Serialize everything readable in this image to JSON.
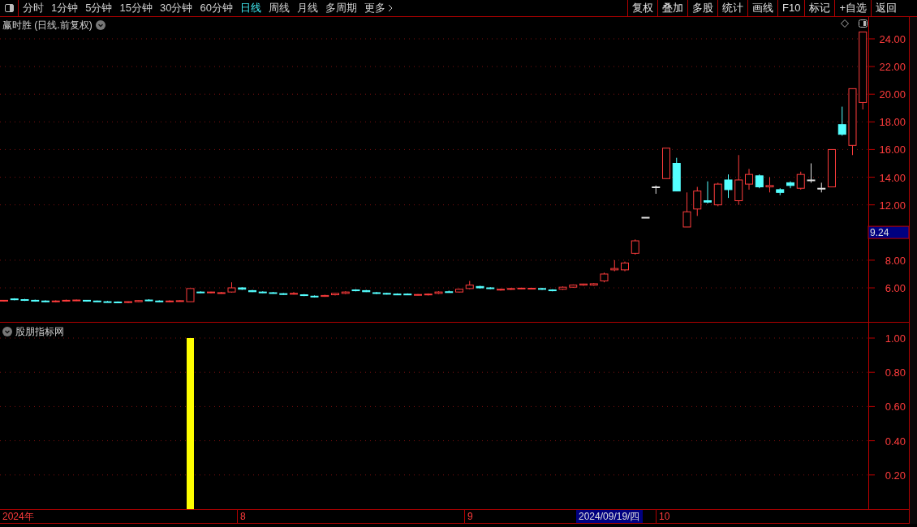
{
  "toolbar": {
    "periods": [
      {
        "label": "分时",
        "selected": false
      },
      {
        "label": "1分钟",
        "selected": false
      },
      {
        "label": "5分钟",
        "selected": false
      },
      {
        "label": "15分钟",
        "selected": false
      },
      {
        "label": "30分钟",
        "selected": false
      },
      {
        "label": "60分钟",
        "selected": false
      },
      {
        "label": "日线",
        "selected": true
      },
      {
        "label": "周线",
        "selected": false
      },
      {
        "label": "月线",
        "selected": false
      },
      {
        "label": "多周期",
        "selected": false
      },
      {
        "label": "更多",
        "selected": false
      }
    ],
    "actions": [
      "复权",
      "叠加",
      "多股",
      "统计",
      "画线",
      "F10",
      "标记",
      "+自选",
      "返回"
    ]
  },
  "price_panel": {
    "title": "赢时胜 (日线.前复权)",
    "price_tag": "9.24",
    "chart_data": {
      "type": "candlestick",
      "ylim": [
        3.54,
        25.58
      ],
      "grid": true,
      "yticks": [
        {
          "value": 24,
          "label": "24.00"
        },
        {
          "value": 22,
          "label": "22.00"
        },
        {
          "value": 20,
          "label": "20.00"
        },
        {
          "value": 18,
          "label": "18.00"
        },
        {
          "value": 16,
          "label": "16.00"
        },
        {
          "value": 14,
          "label": "14.00"
        },
        {
          "value": 12,
          "label": "12.00"
        },
        {
          "value": 8,
          "label": "8.00"
        },
        {
          "value": 6,
          "label": "6.00"
        }
      ],
      "ohlc": [
        [
          5.05,
          5.12,
          5.0,
          5.1
        ],
        [
          5.2,
          5.25,
          5.1,
          5.15
        ],
        [
          5.15,
          5.2,
          5.05,
          5.1
        ],
        [
          5.1,
          5.15,
          5.0,
          5.05
        ],
        [
          5.05,
          5.1,
          4.95,
          5.0
        ],
        [
          5.0,
          5.1,
          4.95,
          5.05
        ],
        [
          5.05,
          5.15,
          5.0,
          5.1
        ],
        [
          5.1,
          5.15,
          5.05,
          5.12
        ],
        [
          5.1,
          5.12,
          5.0,
          5.05
        ],
        [
          5.05,
          5.08,
          4.98,
          5.0
        ],
        [
          5.0,
          5.05,
          4.95,
          4.98
        ],
        [
          4.98,
          5.02,
          4.92,
          4.95
        ],
        [
          4.95,
          5.02,
          4.9,
          5.0
        ],
        [
          5.0,
          5.1,
          4.98,
          5.08
        ],
        [
          5.12,
          5.18,
          5.05,
          5.08
        ],
        [
          5.05,
          5.1,
          4.98,
          5.0
        ],
        [
          5.0,
          5.1,
          4.95,
          5.05
        ],
        [
          5.05,
          5.1,
          5.0,
          5.07
        ],
        [
          5.0,
          5.95,
          5.0,
          5.95
        ],
        [
          5.7,
          5.75,
          5.62,
          5.68
        ],
        [
          5.65,
          5.72,
          5.6,
          5.7
        ],
        [
          5.62,
          5.7,
          5.58,
          5.65
        ],
        [
          5.7,
          6.4,
          5.65,
          6.0
        ],
        [
          6.0,
          6.05,
          5.85,
          5.9
        ],
        [
          5.8,
          5.85,
          5.7,
          5.72
        ],
        [
          5.7,
          5.75,
          5.62,
          5.68
        ],
        [
          5.65,
          5.7,
          5.58,
          5.62
        ],
        [
          5.58,
          5.62,
          5.5,
          5.55
        ],
        [
          5.55,
          5.7,
          5.52,
          5.6
        ],
        [
          5.5,
          5.55,
          5.4,
          5.45
        ],
        [
          5.4,
          5.45,
          5.3,
          5.35
        ],
        [
          5.38,
          5.5,
          5.35,
          5.45
        ],
        [
          5.5,
          5.62,
          5.45,
          5.6
        ],
        [
          5.6,
          5.75,
          5.55,
          5.7
        ],
        [
          5.85,
          5.9,
          5.75,
          5.8
        ],
        [
          5.8,
          5.85,
          5.7,
          5.72
        ],
        [
          5.65,
          5.7,
          5.55,
          5.6
        ],
        [
          5.6,
          5.65,
          5.52,
          5.55
        ],
        [
          5.55,
          5.6,
          5.5,
          5.52
        ],
        [
          5.55,
          5.6,
          5.48,
          5.5
        ],
        [
          5.5,
          5.55,
          5.45,
          5.52
        ],
        [
          5.5,
          5.6,
          5.45,
          5.55
        ],
        [
          5.6,
          5.75,
          5.55,
          5.7
        ],
        [
          5.72,
          5.8,
          5.65,
          5.68
        ],
        [
          5.7,
          5.95,
          5.65,
          5.9
        ],
        [
          5.95,
          6.5,
          5.9,
          6.2
        ],
        [
          6.1,
          6.15,
          5.95,
          6.0
        ],
        [
          6.0,
          6.05,
          5.9,
          5.95
        ],
        [
          5.85,
          5.95,
          5.8,
          5.9
        ],
        [
          5.9,
          6.0,
          5.85,
          5.95
        ],
        [
          5.95,
          6.0,
          5.9,
          5.98
        ],
        [
          5.95,
          6.0,
          5.9,
          5.97
        ],
        [
          5.95,
          6.0,
          5.85,
          5.9
        ],
        [
          5.85,
          5.9,
          5.75,
          5.8
        ],
        [
          5.9,
          6.1,
          5.85,
          6.05
        ],
        [
          6.05,
          6.25,
          6.0,
          6.2
        ],
        [
          6.2,
          6.3,
          6.15,
          6.28
        ],
        [
          6.2,
          6.35,
          6.15,
          6.3
        ],
        [
          6.5,
          7.1,
          6.4,
          7.0
        ],
        [
          7.3,
          8.0,
          7.2,
          7.4
        ],
        [
          7.3,
          7.9,
          7.2,
          7.8
        ],
        [
          8.5,
          9.5,
          8.4,
          9.4
        ],
        [
          11.1,
          11.1,
          11.1,
          11.1
        ],
        [
          13.3,
          13.4,
          12.8,
          13.3
        ],
        [
          13.9,
          16.1,
          13.9,
          16.1
        ],
        [
          15.0,
          15.4,
          13.0,
          13.0
        ],
        [
          10.4,
          12.9,
          10.4,
          11.5
        ],
        [
          11.7,
          13.3,
          11.2,
          13.0
        ],
        [
          12.3,
          13.7,
          12.1,
          12.2
        ],
        [
          12.0,
          13.6,
          11.9,
          13.5
        ],
        [
          13.8,
          14.2,
          12.5,
          13.1
        ],
        [
          12.3,
          15.6,
          12.0,
          13.8
        ],
        [
          13.5,
          14.6,
          13.1,
          14.2
        ],
        [
          14.1,
          14.2,
          13.2,
          13.3
        ],
        [
          13.3,
          14.0,
          12.9,
          13.4
        ],
        [
          13.1,
          13.2,
          12.7,
          12.9
        ],
        [
          13.6,
          13.7,
          13.2,
          13.4
        ],
        [
          13.2,
          14.4,
          13.1,
          14.2
        ],
        [
          13.8,
          15.0,
          13.6,
          13.8
        ],
        [
          13.2,
          13.6,
          12.9,
          13.2
        ],
        [
          13.3,
          16.0,
          13.3,
          16.0
        ],
        [
          17.8,
          19.1,
          17.0,
          17.1
        ],
        [
          16.3,
          20.4,
          15.6,
          20.4
        ],
        [
          19.4,
          24.5,
          18.9,
          24.5
        ]
      ]
    }
  },
  "indicator_panel": {
    "chart_data": {
      "type": "bar",
      "ylim": [
        0,
        1.09
      ],
      "grid": true,
      "yticks": [
        {
          "value": 0.2,
          "label": "0.20"
        },
        {
          "value": 0.4,
          "label": "0.40"
        },
        {
          "value": 0.6,
          "label": "0.60"
        },
        {
          "value": 0.8,
          "label": "0.80"
        },
        {
          "value": 1,
          "label": "1.00"
        }
      ],
      "series": [
        {
          "name": "股朋指标网",
          "color": "#ffff00",
          "values": [
            0,
            0,
            0,
            0,
            0,
            0,
            0,
            0,
            0,
            0,
            0,
            0,
            0,
            0,
            0,
            0,
            0,
            0,
            1,
            0,
            0,
            0,
            0,
            0,
            0,
            0,
            0,
            0,
            0,
            0,
            0,
            0,
            0,
            0,
            0,
            0,
            0,
            0,
            0,
            0,
            0,
            0,
            0,
            0,
            0,
            0,
            0,
            0,
            0,
            0,
            0,
            0,
            0,
            0,
            0,
            0,
            0,
            0,
            0,
            0,
            0,
            0,
            0,
            0,
            0,
            0,
            0,
            0,
            0,
            0,
            0,
            0,
            0,
            0,
            0,
            0,
            0,
            0,
            0,
            0,
            0,
            0,
            0,
            0
          ]
        }
      ]
    }
  },
  "date_axis": {
    "labels": [
      {
        "text": "2024年",
        "selected": false
      },
      {
        "text": "8",
        "selected": false
      },
      {
        "text": "9",
        "selected": false
      },
      {
        "text": "2024/09/19/四",
        "selected": true
      },
      {
        "text": "10",
        "selected": false
      }
    ]
  }
}
